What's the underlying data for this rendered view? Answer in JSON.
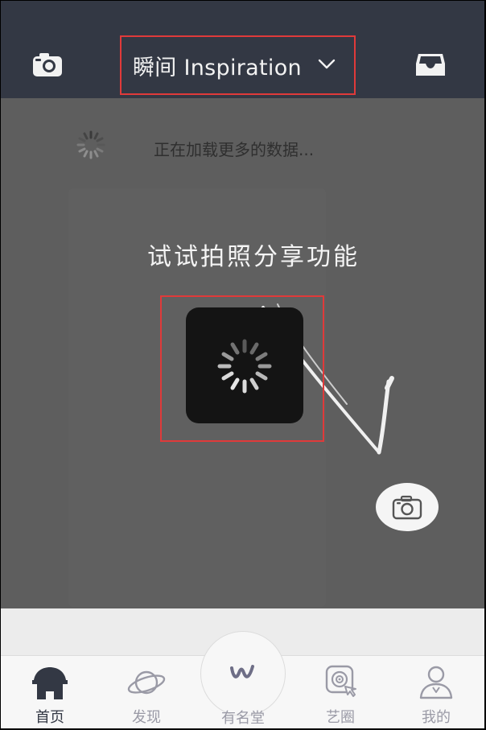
{
  "header": {
    "title": "瞬间 Inspiration",
    "left_icon": "camera-icon",
    "right_icon": "inbox-icon",
    "dropdown_icon": "chevron-down-icon"
  },
  "feed": {
    "loading_text": "正在加载更多的数据..."
  },
  "tutorial": {
    "hint": "试试拍照分享功能"
  },
  "tabs": [
    {
      "label": "首页",
      "icon": "home-icon",
      "active": true
    },
    {
      "label": "发现",
      "icon": "planet-icon",
      "active": false
    },
    {
      "label": "有名堂",
      "icon": "w-logo-icon",
      "active": false
    },
    {
      "label": "艺圈",
      "icon": "target-icon",
      "active": false
    },
    {
      "label": "我的",
      "icon": "user-icon",
      "active": false
    }
  ],
  "colors": {
    "header_bg": "#333844",
    "highlight_border": "#e03a3a",
    "overlay": "#5e5e5e",
    "tab_active": "#333844",
    "tab_inactive": "#9a9aa6"
  }
}
